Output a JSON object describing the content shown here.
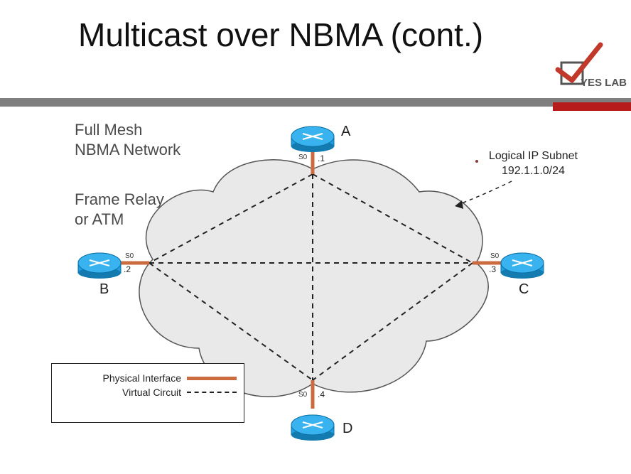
{
  "title": "Multicast over NBMA (cont.)",
  "brand": "YES LAB",
  "labels": {
    "mesh1": "Full Mesh",
    "mesh2": "NBMA Network",
    "tech1": "Frame Relay",
    "tech2": "or ATM",
    "subnet1": "Logical IP Subnet",
    "subnet2": "192.1.1.0/24"
  },
  "legend": {
    "physical": "Physical Interface",
    "virtual": "Virtual Circuit"
  },
  "nodes": {
    "A": {
      "name": "A",
      "iface": ".1",
      "s": "S0"
    },
    "B": {
      "name": "B",
      "iface": ".2",
      "s": "S0"
    },
    "C": {
      "name": "C",
      "iface": ".3",
      "s": "S0"
    },
    "D": {
      "name": "D",
      "iface": ".4",
      "s": "S0"
    }
  }
}
